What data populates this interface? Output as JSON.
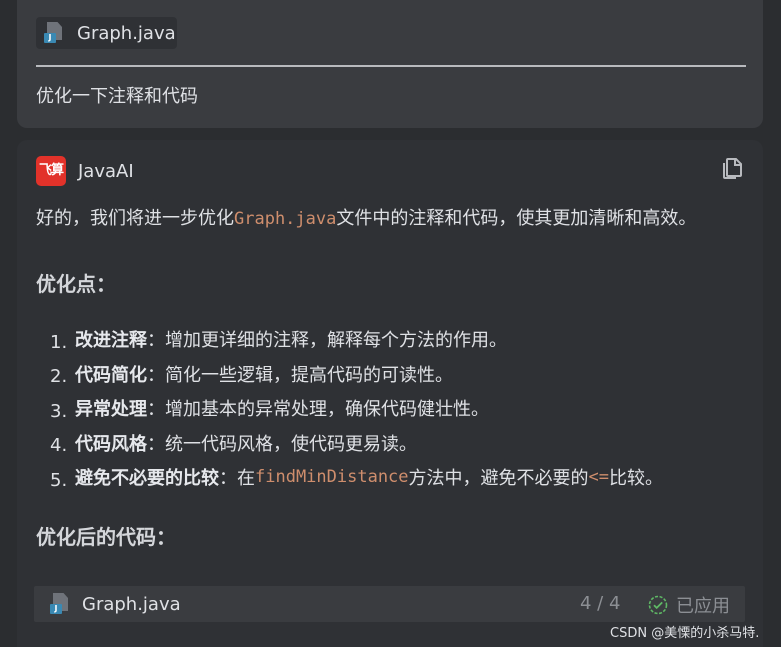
{
  "user_message": {
    "attachment": {
      "file_name": "Graph.java",
      "icon": "java-file-icon"
    },
    "text": "优化一下注释和代码"
  },
  "ai_message": {
    "assistant_avatar_text": "飞算",
    "assistant_name": "JavaAI",
    "copy_icon": "copy-icon",
    "intro": {
      "before": "好的，我们将进一步优化",
      "code": "Graph.java",
      "after": "文件中的注释和代码，使其更加清晰和高效。"
    },
    "heading_points": "优化点：",
    "points": [
      {
        "num": "1.",
        "term": "改进注释",
        "sep": "：",
        "text": "增加更详细的注释，解释每个方法的作用。"
      },
      {
        "num": "2.",
        "term": "代码简化",
        "sep": "：",
        "text": "简化一些逻辑，提高代码的可读性。"
      },
      {
        "num": "3.",
        "term": "异常处理",
        "sep": "：",
        "text": "增加基本的异常处理，确保代码健壮性。"
      },
      {
        "num": "4.",
        "term": "代码风格",
        "sep": "：",
        "text": "统一代码风格，使代码更易读。"
      },
      {
        "num": "5.",
        "term": "避免不必要的比较",
        "sep": "：",
        "text_a": "在",
        "code_a": "findMinDistance",
        "text_b": "方法中，避免不必要的",
        "code_b": "<=",
        "text_c": "比较。"
      }
    ],
    "heading_after": "优化后的代码：",
    "code_file": {
      "file_name": "Graph.java",
      "count": "4 / 4",
      "status": "已应用",
      "status_icon": "check-circle-icon"
    }
  },
  "watermark": "CSDN @美慄的小杀马特."
}
